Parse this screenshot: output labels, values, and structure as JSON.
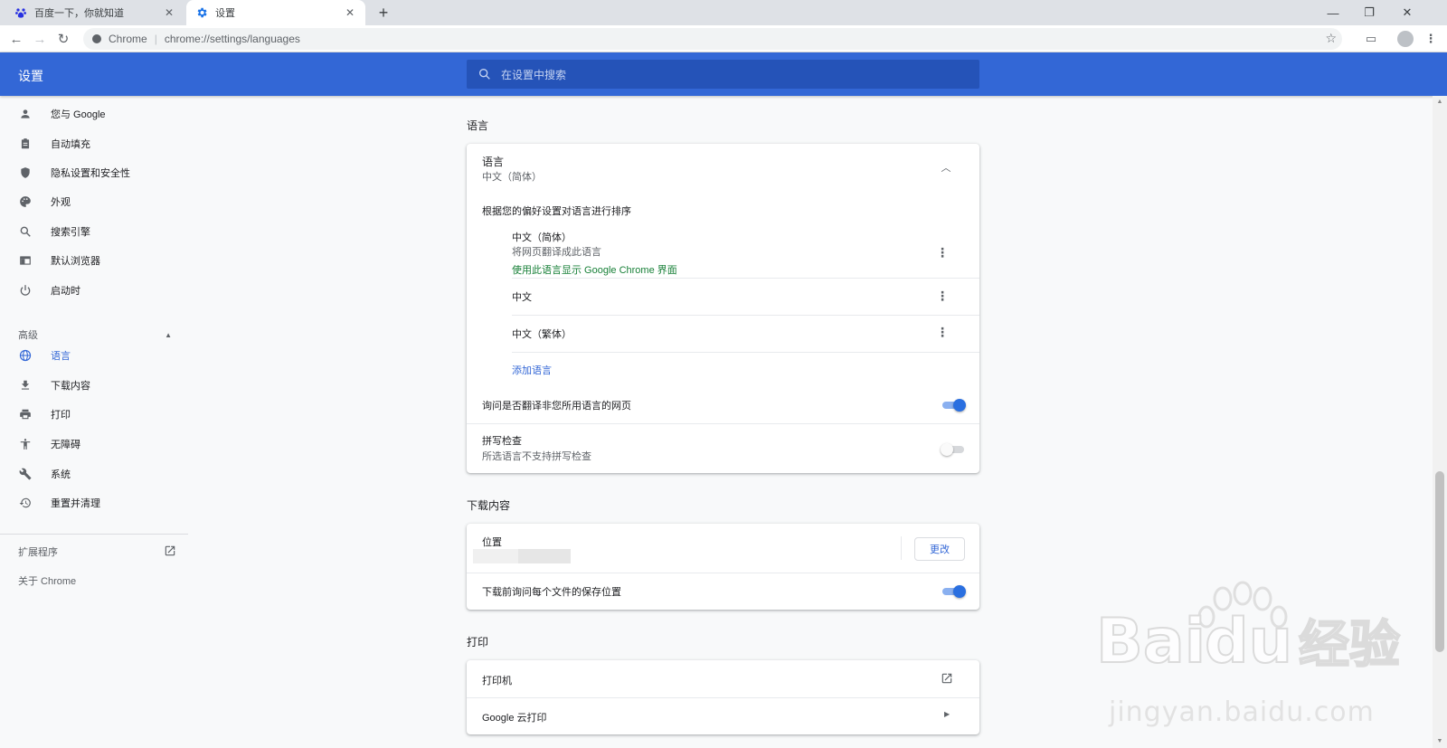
{
  "tabs": [
    {
      "title": "百度一下，你就知道",
      "icon": "baidu-paw-icon"
    },
    {
      "title": "设置",
      "icon": "settings-gear-icon"
    }
  ],
  "toolbar": {
    "site_chip": "Chrome",
    "url": "chrome://settings/languages"
  },
  "header": {
    "title": "设置",
    "search_placeholder": "在设置中搜索"
  },
  "sidebar": {
    "items": [
      {
        "label": "您与 Google",
        "icon": "person-icon"
      },
      {
        "label": "自动填充",
        "icon": "clipboard-icon"
      },
      {
        "label": "隐私设置和安全性",
        "icon": "shield-icon"
      },
      {
        "label": "外观",
        "icon": "palette-icon"
      },
      {
        "label": "搜索引擎",
        "icon": "search-icon"
      },
      {
        "label": "默认浏览器",
        "icon": "browser-window-icon"
      },
      {
        "label": "启动时",
        "icon": "power-icon"
      }
    ],
    "advanced_label": "高级",
    "advanced_items": [
      {
        "label": "语言",
        "icon": "globe-icon",
        "active": true
      },
      {
        "label": "下载内容",
        "icon": "download-icon"
      },
      {
        "label": "打印",
        "icon": "printer-icon"
      },
      {
        "label": "无障碍",
        "icon": "accessibility-icon"
      },
      {
        "label": "系统",
        "icon": "wrench-icon"
      },
      {
        "label": "重置并清理",
        "icon": "history-icon"
      }
    ],
    "extensions_label": "扩展程序",
    "about_label": "关于 Chrome"
  },
  "languages": {
    "section_title": "语言",
    "header_label": "语言",
    "header_value": "中文（简体）",
    "order_label": "根据您的偏好设置对语言进行排序",
    "list": [
      {
        "name": "中文（简体）",
        "sub": "将网页翻译成此语言",
        "note": "使用此语言显示 Google Chrome 界面"
      },
      {
        "name": "中文"
      },
      {
        "name": "中文（繁体）"
      }
    ],
    "add_language": "添加语言",
    "offer_translate_label": "询问是否翻译非您所用语言的网页",
    "offer_translate_on": true,
    "spellcheck_label": "拼写检查",
    "spellcheck_sub": "所选语言不支持拼写检查",
    "spellcheck_on": false
  },
  "downloads": {
    "section_title": "下载内容",
    "location_label": "位置",
    "change_button": "更改",
    "ask_label": "下载前询问每个文件的保存位置",
    "ask_on": true
  },
  "printing": {
    "section_title": "打印",
    "printers_label": "打印机",
    "cloud_print_label": "Google 云打印"
  },
  "watermark": {
    "brand": "Baidu经验",
    "site": "jingyan.baidu.com"
  },
  "colors": {
    "header_blue": "#3367d6",
    "toggle_on": "#2a6fe0",
    "link_green": "#188038"
  }
}
